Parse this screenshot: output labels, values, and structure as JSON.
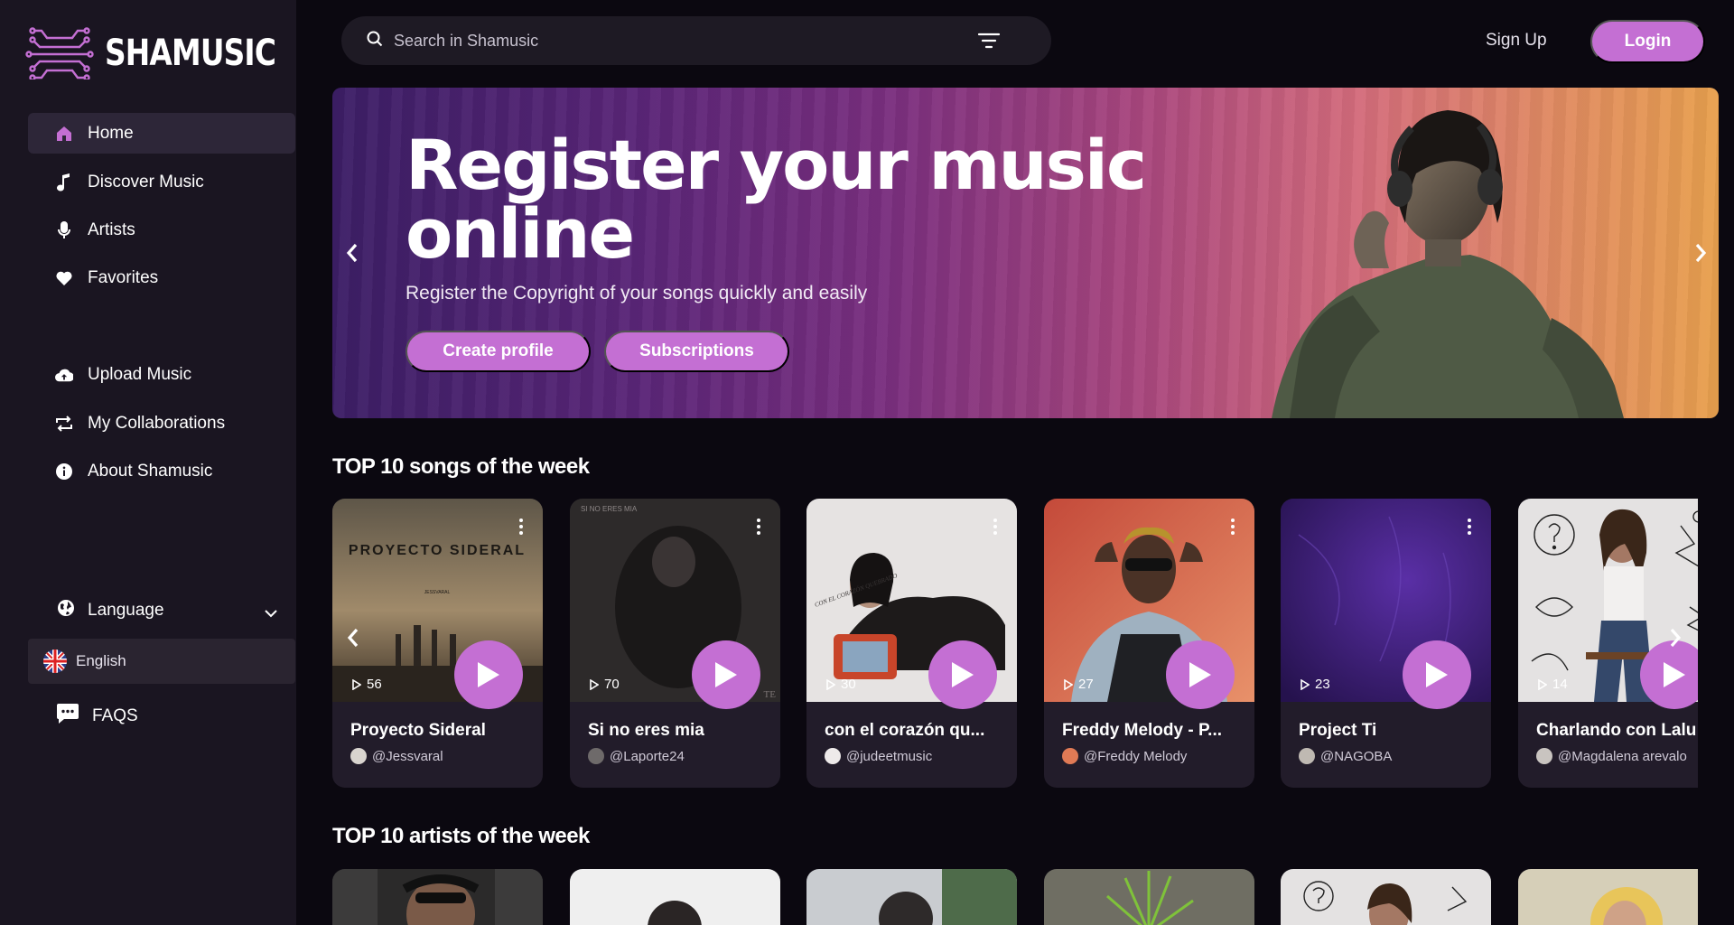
{
  "app": {
    "logo_text": "SHAMUSIC"
  },
  "sidebar": {
    "items": [
      {
        "label": "Home",
        "icon": "home-icon",
        "active": true
      },
      {
        "label": "Discover Music",
        "icon": "music-note-icon"
      },
      {
        "label": "Artists",
        "icon": "microphone-icon"
      },
      {
        "label": "Favorites",
        "icon": "heart-icon"
      },
      {
        "label": "Upload Music",
        "icon": "cloud-upload-icon"
      },
      {
        "label": "My Collaborations",
        "icon": "repeat-icon"
      },
      {
        "label": "About Shamusic",
        "icon": "info-icon"
      }
    ],
    "language_label": "Language",
    "language_selected": "English",
    "faqs_label": "FAQS"
  },
  "header": {
    "search_placeholder": "Search in Shamusic",
    "signup_label": "Sign Up",
    "login_label": "Login"
  },
  "hero": {
    "title_line1": "Register your music",
    "title_line2": "online",
    "subtitle": "Register the Copyright of your songs quickly and easily",
    "create_profile_label": "Create profile",
    "subscriptions_label": "Subscriptions"
  },
  "top_songs": {
    "title": "TOP 10 songs of the week",
    "songs": [
      {
        "title": "Proyecto Sideral",
        "artist": "@Jessvaral",
        "plays": "56",
        "art_text": "PROYECTO SIDERAL",
        "art_small": "JESSVARAL"
      },
      {
        "title": "Si no eres mia",
        "artist": "@Laporte24",
        "plays": "70",
        "art_text": "SI NO ERES MIA",
        "art_small": "TE"
      },
      {
        "title": "con el corazón qu...",
        "artist": "@judeetmusic",
        "plays": "30",
        "art_text": "CON EL CORAZÓN QUEBRADO"
      },
      {
        "title": "Freddy Melody - P...",
        "artist": "@Freddy Melody",
        "plays": "27"
      },
      {
        "title": "Project Ti",
        "artist": "@NAGOBA",
        "plays": "23"
      },
      {
        "title": "Charlando con Lalu",
        "artist": "@Magdalena arevalo",
        "plays": "14"
      }
    ]
  },
  "top_artists": {
    "title": "TOP 10 artists of the week"
  },
  "colors": {
    "accent": "#c46fd3",
    "background": "#0b0810",
    "sidebar": "#1a1521"
  }
}
